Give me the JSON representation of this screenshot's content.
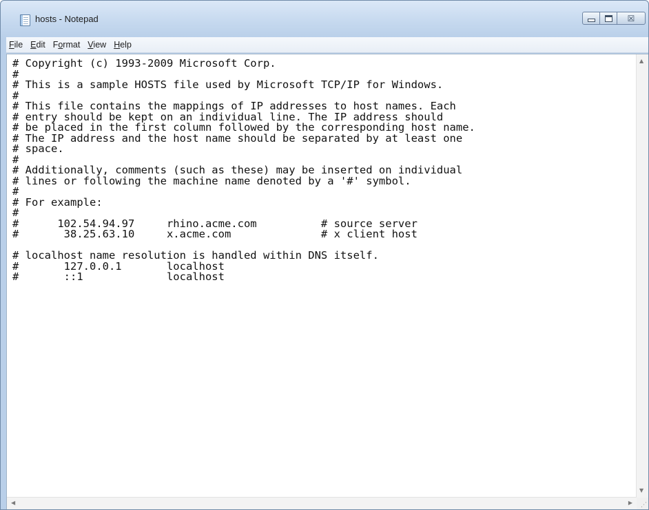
{
  "window": {
    "title": "hosts - Notepad",
    "icon": "notepad-icon",
    "caption_buttons": {
      "minimize": "minimize-icon",
      "maximize": "maximize-icon",
      "close": "close-icon",
      "close_glyph": "☒"
    }
  },
  "menu": {
    "items": [
      {
        "first": "F",
        "rest": "ile"
      },
      {
        "first": "E",
        "rest": "dit"
      },
      {
        "first": "F",
        "rest": "ormat",
        "underline_index": 1
      },
      {
        "first": "V",
        "rest": "iew"
      },
      {
        "first": "H",
        "rest": "elp"
      }
    ]
  },
  "editor": {
    "content": "# Copyright (c) 1993-2009 Microsoft Corp.\n#\n# This is a sample HOSTS file used by Microsoft TCP/IP for Windows.\n#\n# This file contains the mappings of IP addresses to host names. Each\n# entry should be kept on an individual line. The IP address should\n# be placed in the first column followed by the corresponding host name.\n# The IP address and the host name should be separated by at least one\n# space.\n#\n# Additionally, comments (such as these) may be inserted on individual\n# lines or following the machine name denoted by a '#' symbol.\n#\n# For example:\n#\n#      102.54.94.97     rhino.acme.com          # source server\n#       38.25.63.10     x.acme.com              # x client host\n\n# localhost name resolution is handled within DNS itself.\n#\t127.0.0.1       localhost\n#\t::1             localhost"
  },
  "scrollbars": {
    "up": "▲",
    "down": "▼",
    "left": "◀",
    "right": "▶",
    "grip": "⋰"
  },
  "colors": {
    "title_bar": "#c6d9ef",
    "editor_bg": "#ffffff"
  }
}
